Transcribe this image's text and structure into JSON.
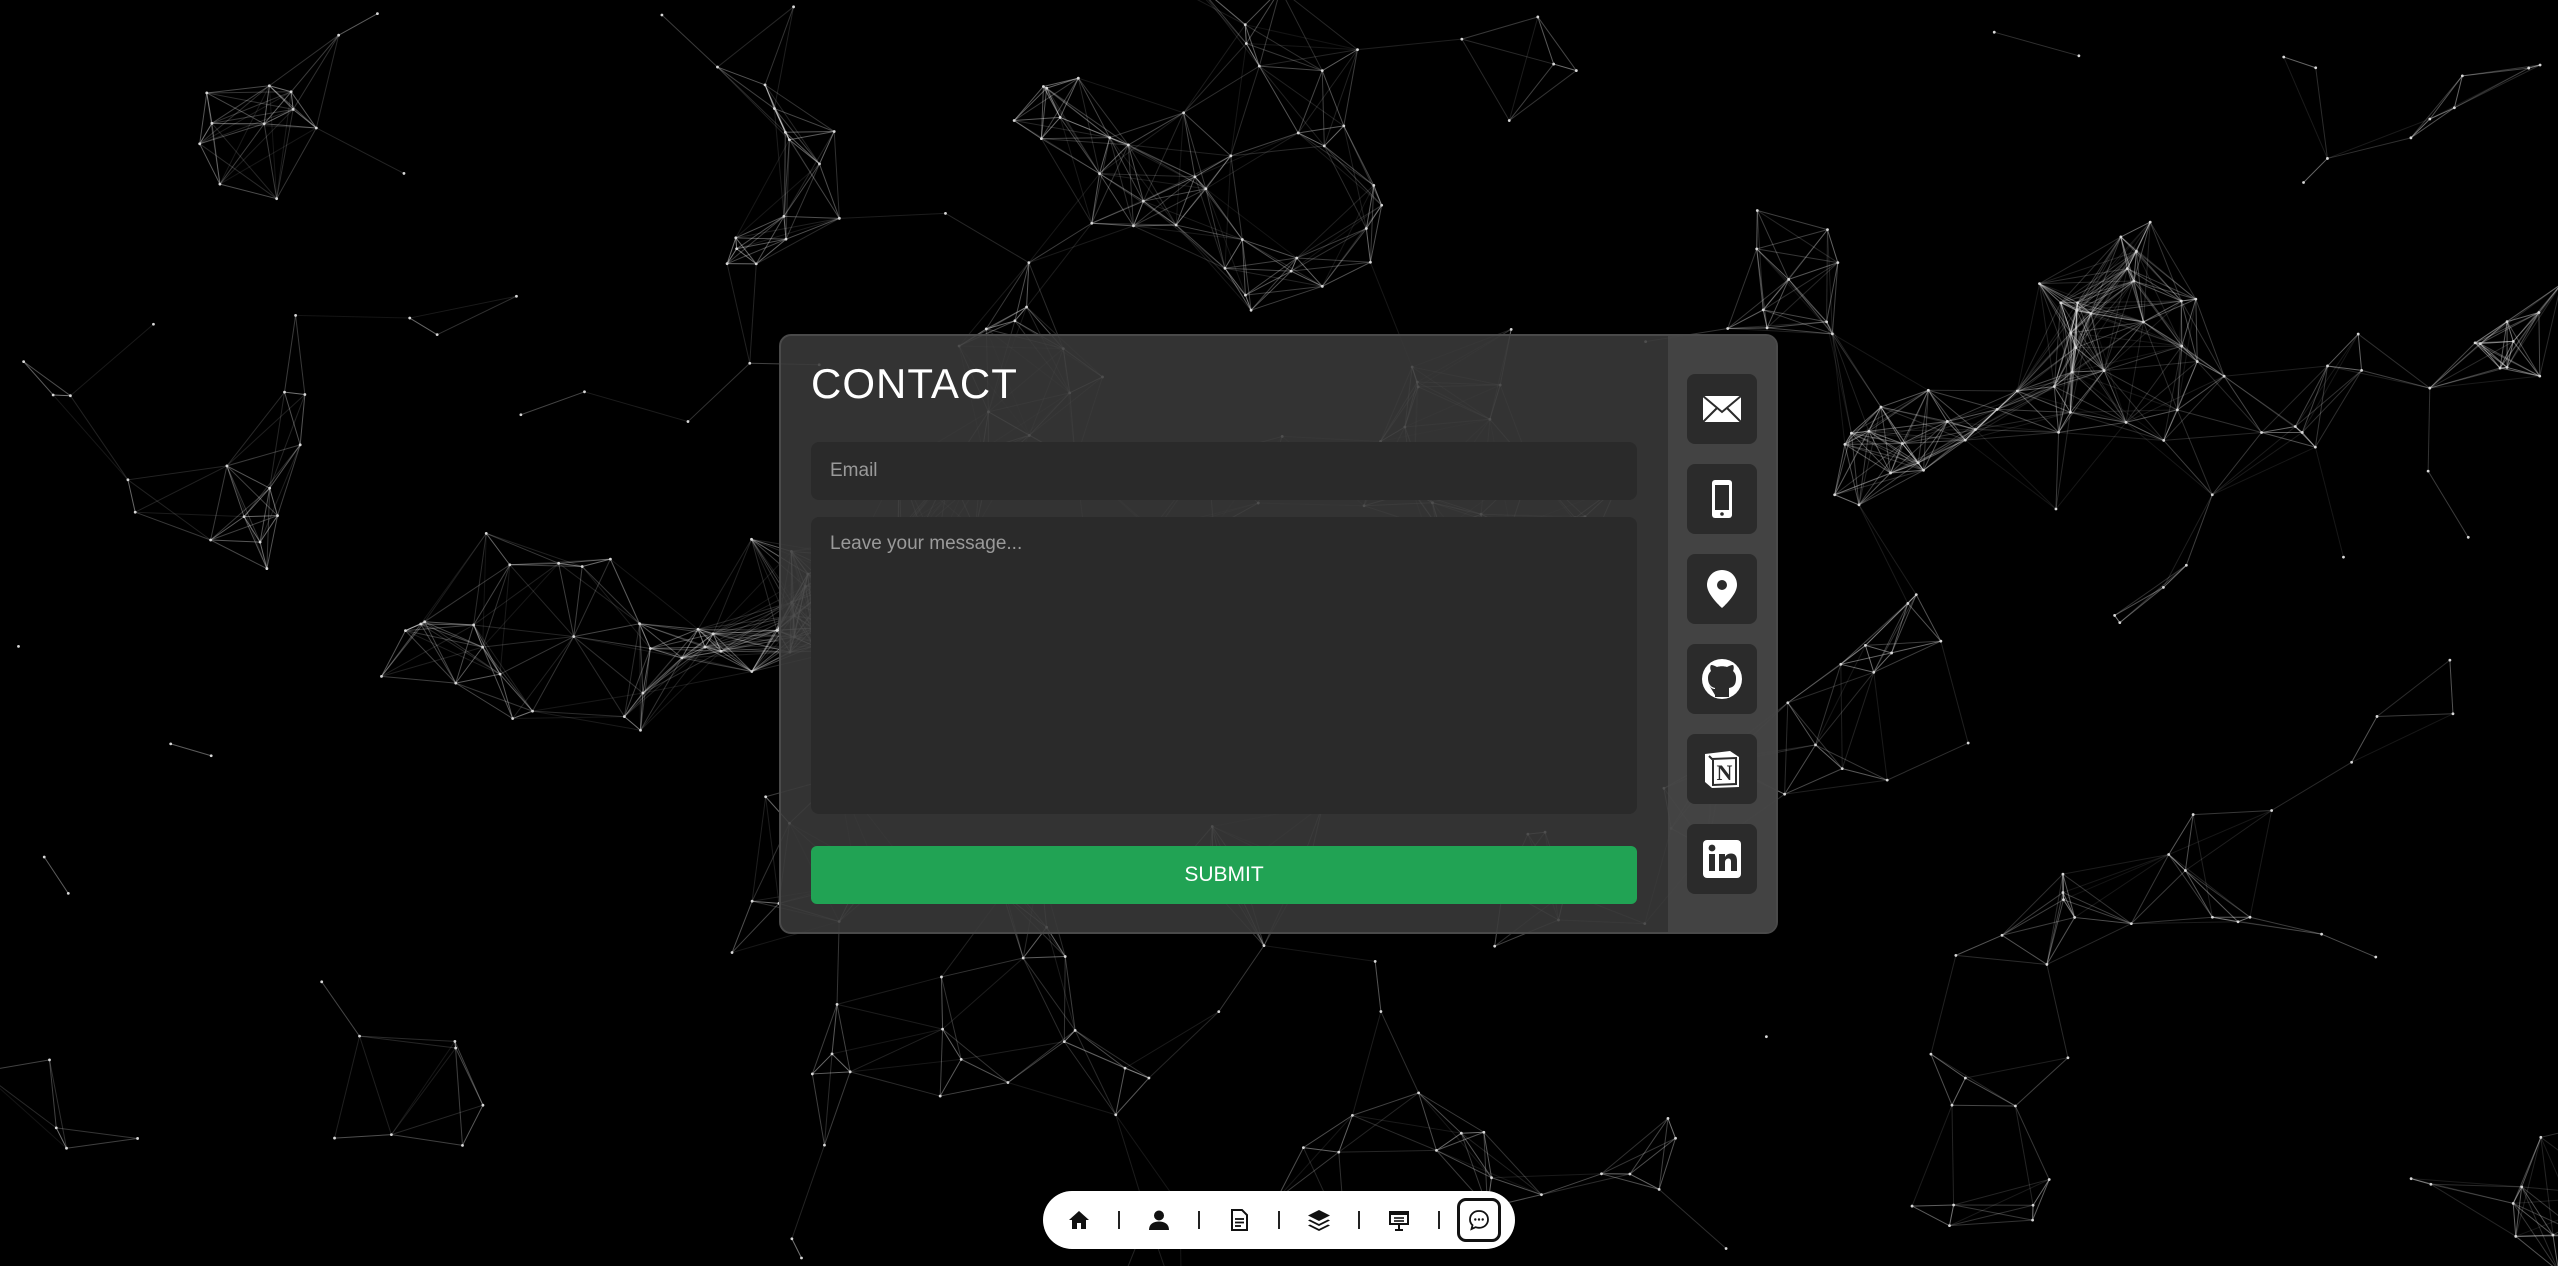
{
  "contact": {
    "title": "CONTACT",
    "email_placeholder": "Email",
    "message_placeholder": "Leave your message...",
    "submit_label": "SUBMIT",
    "accent_color": "#21a354"
  },
  "social": [
    {
      "icon": "mail-icon"
    },
    {
      "icon": "phone-icon"
    },
    {
      "icon": "location-pin-icon"
    },
    {
      "icon": "github-icon"
    },
    {
      "icon": "notion-icon"
    },
    {
      "icon": "linkedin-icon"
    }
  ],
  "dock": [
    {
      "icon": "home-icon",
      "active": false
    },
    {
      "icon": "user-icon",
      "active": false
    },
    {
      "icon": "document-icon",
      "active": false
    },
    {
      "icon": "layers-icon",
      "active": false
    },
    {
      "icon": "presentation-icon",
      "active": false
    },
    {
      "icon": "chat-icon",
      "active": true
    }
  ]
}
